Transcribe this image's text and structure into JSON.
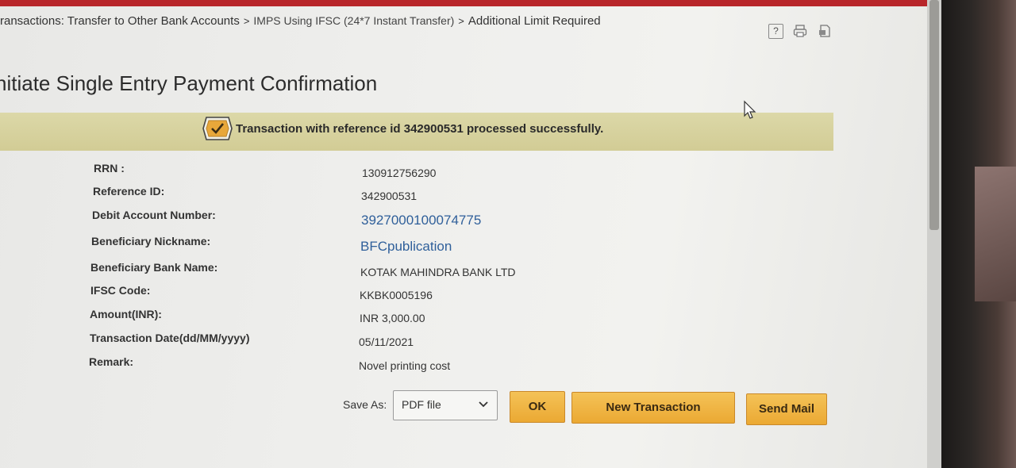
{
  "breadcrumb": {
    "part1": "ransactions: Transfer to Other Bank Accounts",
    "part2": "IMPS Using IFSC (24*7 Instant Transfer)",
    "part3": "Additional Limit Required",
    "separator": ">"
  },
  "toolbar": {
    "help_label": "?",
    "icons": [
      "help-icon",
      "print-icon",
      "export-icon"
    ]
  },
  "page_title": "nitiate Single Entry Payment Confirmation",
  "banner": {
    "message": "Transaction with reference id 342900531 processed successfully.",
    "icon": "success-check-icon"
  },
  "details": [
    {
      "label": "RRN :",
      "value": "130912756290"
    },
    {
      "label": "Reference ID:",
      "value": "342900531"
    },
    {
      "label": "Debit Account Number:",
      "value": "3927000100074775"
    },
    {
      "label": "Beneficiary Nickname:",
      "value": "BFCpublication"
    },
    {
      "label": "Beneficiary Bank Name:",
      "value": "KOTAK MAHINDRA BANK LTD"
    },
    {
      "label": "IFSC Code:",
      "value": "KKBK0005196"
    },
    {
      "label": "Amount(INR):",
      "value": "INR 3,000.00"
    },
    {
      "label": "Transaction Date(dd/MM/yyyy)",
      "value": "05/11/2021"
    },
    {
      "label": "Remark:",
      "value": "Novel printing cost"
    }
  ],
  "actions": {
    "save_as_label": "Save As:",
    "save_as_value": "PDF file",
    "ok_label": "OK",
    "new_transaction_label": "New Transaction",
    "send_mail_label": "Send Mail"
  },
  "colors": {
    "banner_bg": "#d6d09c",
    "button_bg": "#eeb040",
    "link_text": "#2f5f9a",
    "top_band": "#b8262a"
  }
}
